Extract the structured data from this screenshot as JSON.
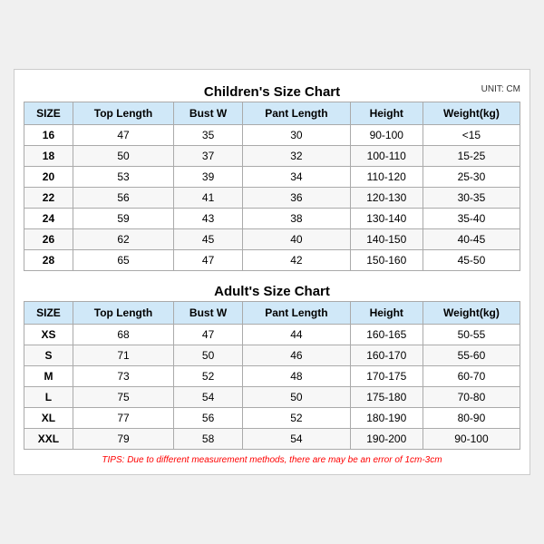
{
  "children": {
    "title": "Children's Size Chart",
    "unit": "UNIT: CM",
    "headers": [
      "SIZE",
      "Top Length",
      "Bust W",
      "Pant Length",
      "Height",
      "Weight(kg)"
    ],
    "rows": [
      [
        "16",
        "47",
        "35",
        "30",
        "90-100",
        "<15"
      ],
      [
        "18",
        "50",
        "37",
        "32",
        "100-110",
        "15-25"
      ],
      [
        "20",
        "53",
        "39",
        "34",
        "110-120",
        "25-30"
      ],
      [
        "22",
        "56",
        "41",
        "36",
        "120-130",
        "30-35"
      ],
      [
        "24",
        "59",
        "43",
        "38",
        "130-140",
        "35-40"
      ],
      [
        "26",
        "62",
        "45",
        "40",
        "140-150",
        "40-45"
      ],
      [
        "28",
        "65",
        "47",
        "42",
        "150-160",
        "45-50"
      ]
    ]
  },
  "adults": {
    "title": "Adult's Size Chart",
    "headers": [
      "SIZE",
      "Top Length",
      "Bust W",
      "Pant Length",
      "Height",
      "Weight(kg)"
    ],
    "rows": [
      [
        "XS",
        "68",
        "47",
        "44",
        "160-165",
        "50-55"
      ],
      [
        "S",
        "71",
        "50",
        "46",
        "160-170",
        "55-60"
      ],
      [
        "M",
        "73",
        "52",
        "48",
        "170-175",
        "60-70"
      ],
      [
        "L",
        "75",
        "54",
        "50",
        "175-180",
        "70-80"
      ],
      [
        "XL",
        "77",
        "56",
        "52",
        "180-190",
        "80-90"
      ],
      [
        "XXL",
        "79",
        "58",
        "54",
        "190-200",
        "90-100"
      ]
    ]
  },
  "tips": "TIPS: Due to different measurement methods, there are may be an error of 1cm-3cm"
}
